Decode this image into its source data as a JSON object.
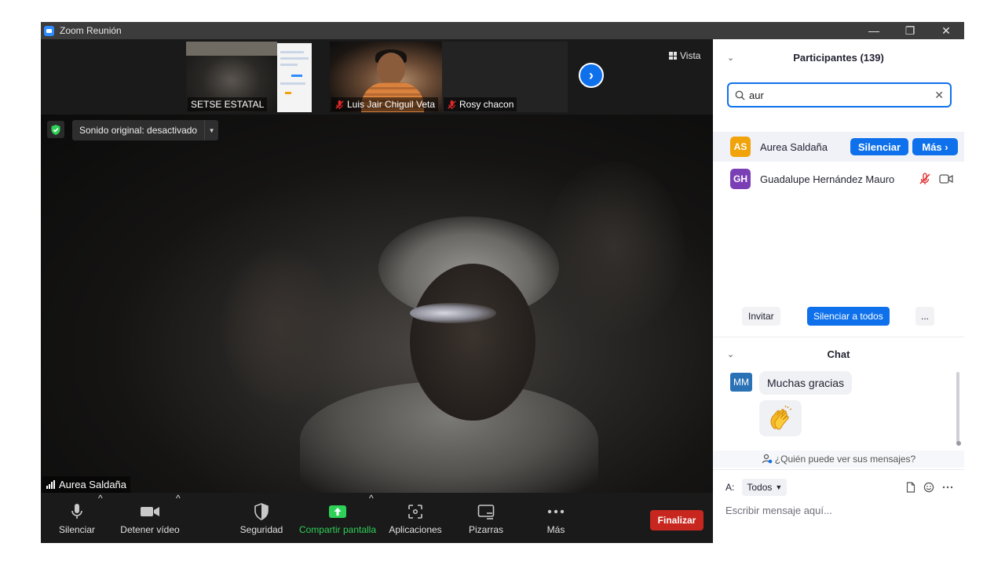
{
  "window": {
    "title": "Zoom Reunión",
    "controls": {
      "minimize": "—",
      "restore": "❐",
      "close": "✕"
    }
  },
  "thumbnails": [
    {
      "name": "SETSE ESTATAL",
      "muted": false
    },
    {
      "name": "Luis Jair Chiguil Veta",
      "muted": true
    },
    {
      "name": "Rosy chacon",
      "muted": true
    }
  ],
  "view_button": {
    "label": "Vista"
  },
  "main_video": {
    "audio_setting": "Sonido original: desactivado",
    "speaker_name": "Aurea Saldaña"
  },
  "toolbar": {
    "mute": "Silenciar",
    "stop_video": "Detener vídeo",
    "security": "Seguridad",
    "share_screen": "Compartir pantalla",
    "apps": "Aplicaciones",
    "whiteboards": "Pizarras",
    "more": "Más",
    "end": "Finalizar"
  },
  "participants": {
    "title": "Participantes (139)",
    "search_value": "aur",
    "list": [
      {
        "initials": "AS",
        "name": "Aurea Saldaña",
        "color": "#f0a30a"
      },
      {
        "initials": "GH",
        "name": "Guadalupe Hernández Mauro",
        "color": "#7b3fb5"
      }
    ],
    "row_actions": {
      "mute": "Silenciar",
      "more": "Más ›"
    },
    "invite": "Invitar",
    "mute_all": "Silenciar a todos",
    "more_options": "..."
  },
  "chat": {
    "title": "Chat",
    "messages": [
      {
        "sender_initials": "MM",
        "text": "Muchas gracias"
      }
    ],
    "visibility_note": "¿Quién puede ver sus mensajes?",
    "to_label": "A:",
    "recipient": "Todos",
    "input_placeholder": "Escribir mensaje aquí..."
  },
  "colors": {
    "zoom_blue": "#0e71eb",
    "end_red": "#c8271f",
    "share_green": "#2ed157",
    "muted_red": "#e02828"
  }
}
